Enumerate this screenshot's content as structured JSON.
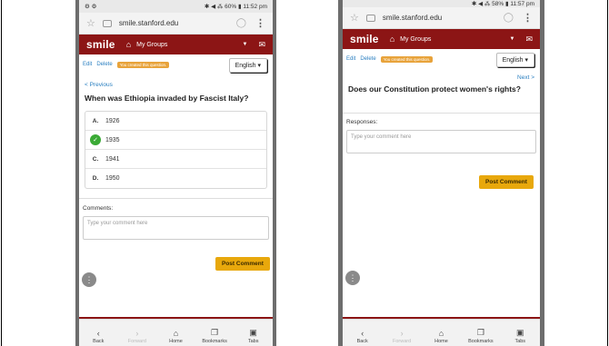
{
  "left": {
    "status": {
      "left": "⚙ ⚙",
      "right": "✱ ◀ ⁂ 60% ▮ 11:52 pm"
    },
    "url": "smile.stanford.edu",
    "app": {
      "logo": "smile",
      "groups": "My Groups"
    },
    "edit": "Edit",
    "delete": "Delete",
    "badge": "You created this question.",
    "language": "English ▾",
    "nav": "< Previous",
    "question": "When was Ethiopia invaded by Fascist Italy?",
    "options": [
      {
        "letter": "A.",
        "text": "1926"
      },
      {
        "letter": "",
        "text": "1935",
        "correct": true
      },
      {
        "letter": "C.",
        "text": "1941"
      },
      {
        "letter": "D.",
        "text": "1950"
      }
    ],
    "comments_label": "Comments:",
    "comment_placeholder": "Type your comment here",
    "post": "Post Comment"
  },
  "right": {
    "status": {
      "right": "✱ ◀ ⁂ 58% ▮ 11:57 pm"
    },
    "url": "smile.stanford.edu",
    "app": {
      "logo": "smile",
      "groups": "My Groups"
    },
    "edit": "Edit",
    "delete": "Delete",
    "badge": "You created this question.",
    "language": "English ▾",
    "nav": "Next >",
    "question": "Does our Constitution protect women's rights?",
    "responses_label": "Responses:",
    "comment_placeholder": "Type your comment here",
    "post": "Post Comment"
  },
  "bottom_nav": [
    "Back",
    "Forward",
    "Home",
    "Bookmarks",
    "Tabs"
  ]
}
